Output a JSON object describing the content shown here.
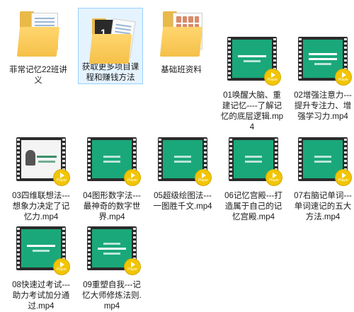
{
  "files": [
    {
      "label": "菲常记忆22班讲义",
      "kind": "folder",
      "icon": "folder-docs-icon"
    },
    {
      "label": "获取更多项目课程和赚钱方法",
      "kind": "folder",
      "icon": "folder-book-icon",
      "selected": true
    },
    {
      "label": "基础班资料",
      "kind": "folder",
      "icon": "folder-images-icon"
    },
    {
      "label": "01唤醒大脑、重建记忆----了解记忆的底层逻辑.mp4",
      "kind": "video",
      "icon": "video-icon"
    },
    {
      "label": "02增强注意力---提升专注力、增强学习力.mp4",
      "kind": "video",
      "icon": "video-icon"
    },
    {
      "label": "03四维联想法---想象力决定了记忆力.mp4",
      "kind": "video",
      "icon": "video-icon"
    },
    {
      "label": "04图形数字法---最神奇的数字世界.mp4",
      "kind": "video",
      "icon": "video-icon"
    },
    {
      "label": "05超级绘图法---一图胜千文.mp4",
      "kind": "video",
      "icon": "video-icon"
    },
    {
      "label": "06记忆宫殿---打造属于自己的记忆宫殿.mp4",
      "kind": "video",
      "icon": "video-icon"
    },
    {
      "label": "07右脑记单词---单词速记的五大方法.mp4",
      "kind": "video",
      "icon": "video-icon"
    },
    {
      "label": "08快速过考试---助力考试加分通过.mp4",
      "kind": "video",
      "icon": "video-icon"
    },
    {
      "label": "09重塑自我---记忆大师修炼法则.mp4",
      "kind": "video",
      "icon": "video-icon"
    }
  ],
  "play_badge_text": "Player"
}
